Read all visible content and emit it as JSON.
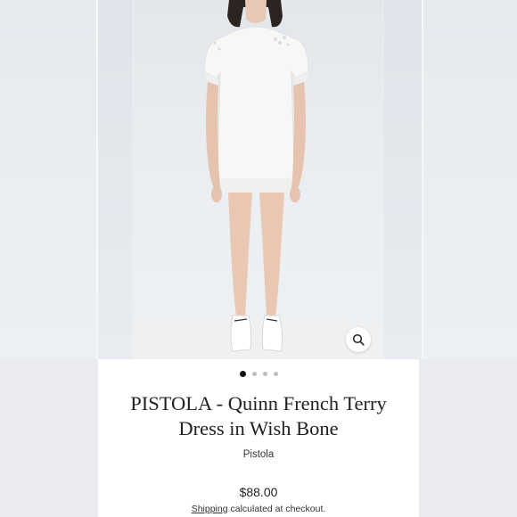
{
  "product": {
    "title_line1": "PISTOLA - Quinn French Terry",
    "title_line2": "Dress in Wish Bone",
    "vendor": "Pistola",
    "price": "$88.00",
    "shipping_link": "Shipping",
    "shipping_rest": " calculated at checkout."
  },
  "gallery": {
    "slide_count": 4,
    "active_slide": 1
  },
  "icons": {
    "zoom": "magnifier-icon"
  },
  "colors": {
    "background": "#eef0f2",
    "panel": "#ffffff",
    "dress": "#f7f7f5",
    "active_dot": "#111111",
    "inactive_dot": "#bdbdbd"
  }
}
